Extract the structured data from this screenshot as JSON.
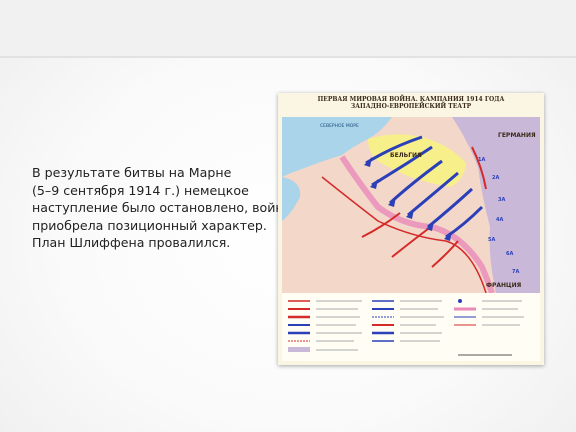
{
  "top_band_color": "#f1f1f1",
  "body_text": {
    "lines": [
      "В результате битвы на Марне",
      "(5–9 сентября 1914 г.) немецкое",
      "наступление было остановлено, война",
      "приобрела позиционный характер.",
      "План Шлиффена провалился."
    ]
  },
  "map": {
    "title_line1": "ПЕРВАЯ МИРОВАЯ ВОЙНА. КАМПАНИЯ 1914 ГОДА",
    "title_line2": "ЗАПАДНО-ЕВРОПЕЙСКИЙ ТЕАТР",
    "labels": {
      "sea": "СЕВЕРНОЕ МОРЕ",
      "belgium": "БЕЛЬГИЯ",
      "germany": "ГЕРМАНИЯ",
      "france": "ФРАНЦИЯ"
    },
    "army_numbers": [
      "1А",
      "2А",
      "3А",
      "4А",
      "5А",
      "6А",
      "7А"
    ],
    "colors": {
      "german": "#2a3fb8",
      "allied": "#d42a2a",
      "sea": "#a9d4ea",
      "belgium": "#f7ef8a",
      "germany_land": "#c9b8d8",
      "france_land": "#f3d7c9",
      "front": "#e98ab9"
    }
  }
}
